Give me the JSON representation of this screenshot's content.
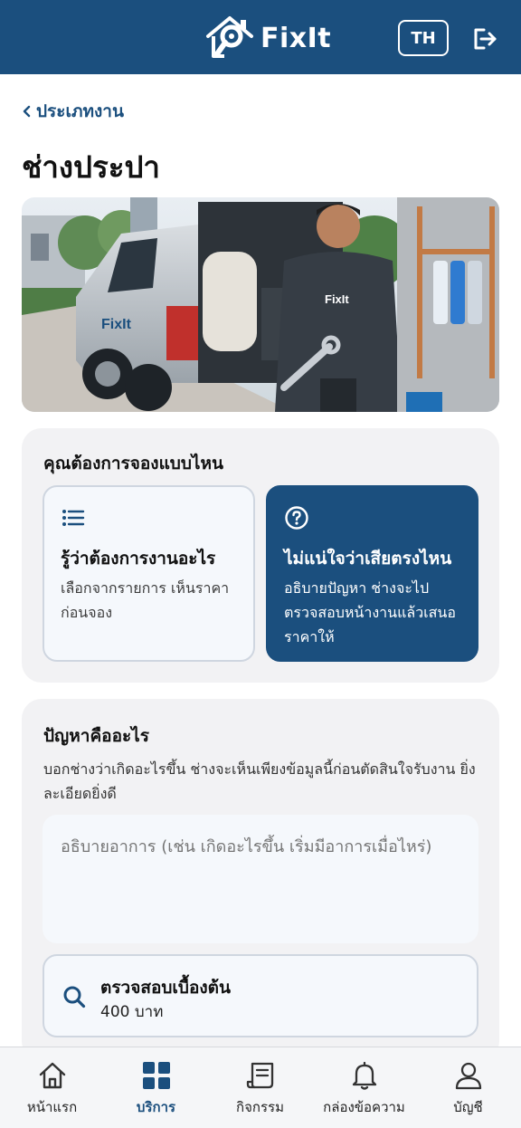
{
  "header": {
    "brand": "FixIt",
    "language": "TH",
    "logo_icon": "house-wrench-logo",
    "logout_icon": "logout-icon",
    "color": "#1b4f7e"
  },
  "back_label": "ประเภทงาน",
  "page_title": "ช่างประปา",
  "hero": {
    "badge": "FixIt",
    "van_badge": "FixIt"
  },
  "booking_type": {
    "title": "คุณต้องการจองแบบไหน",
    "options": [
      {
        "icon": "list-icon",
        "heading": "รู้ว่าต้องการงานอะไร",
        "description": "เลือกจากรายการ เห็นราคาก่อนจอง",
        "selected": false
      },
      {
        "icon": "question-icon",
        "heading": "ไม่แน่ใจว่าเสียตรงไหน",
        "description": "อธิบายปัญหา ช่างจะไปตรวจสอบหน้างานแล้วเสนอราคาให้",
        "selected": true
      }
    ]
  },
  "problem": {
    "title": "ปัญหาคืออะไร",
    "subtitle": "บอกช่างว่าเกิดอะไรขึ้น ช่างจะเห็นเพียงข้อมูลนี้ก่อนตัดสินใจรับงาน ยิ่งละเอียดยิ่งดี",
    "placeholder": "อธิบายอาการ (เช่น เกิดอะไรขึ้น เริ่มมีอาการเมื่อไหร่)",
    "value": "",
    "service": {
      "icon": "search-icon",
      "name": "ตรวจสอบเบื้องต้น",
      "price": "400 บาท"
    }
  },
  "nav": [
    {
      "label": "หน้าแรก",
      "icon": "home-icon",
      "active": false
    },
    {
      "label": "บริการ",
      "icon": "grid-icon",
      "active": true
    },
    {
      "label": "กิจกรรม",
      "icon": "receipt-icon",
      "active": false
    },
    {
      "label": "กล่องข้อความ",
      "icon": "bell-icon",
      "active": false
    },
    {
      "label": "บัญชี",
      "icon": "user-icon",
      "active": false
    }
  ]
}
